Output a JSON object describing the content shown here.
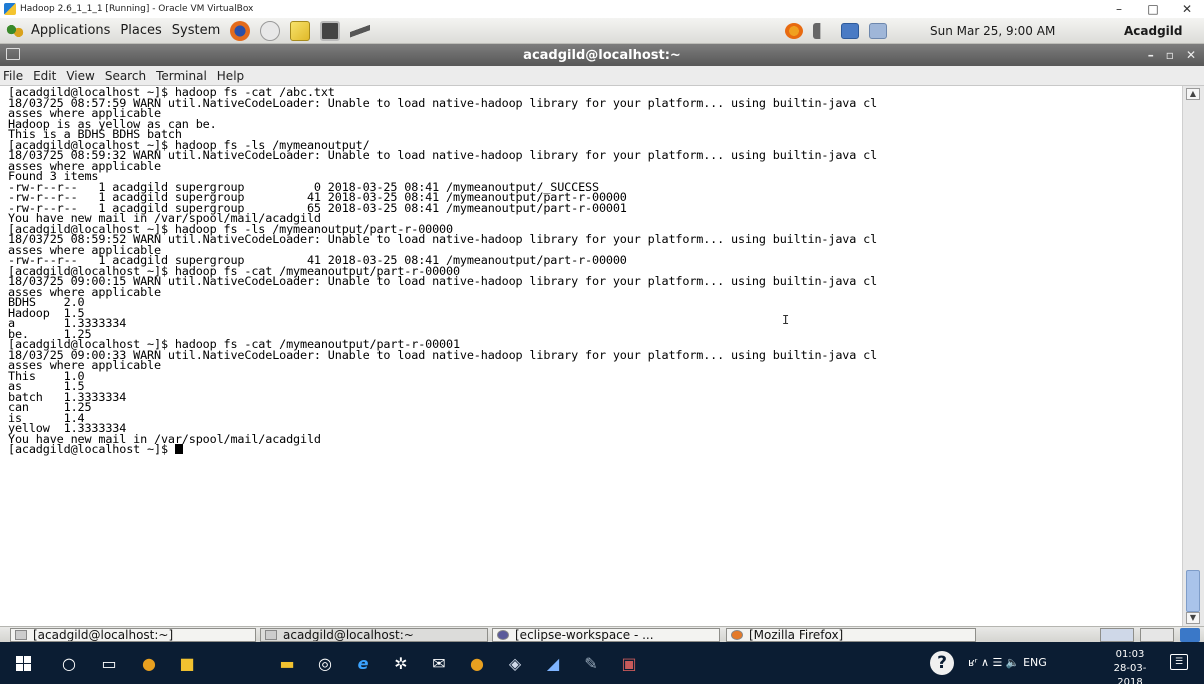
{
  "host_window": {
    "title": "Hadoop 2.6_1_1_1 [Running] - Oracle VM VirtualBox",
    "controls": [
      "–",
      "□",
      "✕"
    ]
  },
  "gnome_panel": {
    "menus": [
      "Applications",
      "Places",
      "System"
    ],
    "clock": "Sun Mar 25, 9:00 AM",
    "user": "Acadgild"
  },
  "terminal": {
    "title": "acadgild@localhost:~",
    "window_controls": [
      "–",
      "▫",
      "✕"
    ],
    "menu": [
      "File",
      "Edit",
      "View",
      "Search",
      "Terminal",
      "Help"
    ],
    "lines": [
      "[acadgild@localhost ~]$ hadoop fs -cat /abc.txt",
      "18/03/25 08:57:59 WARN util.NativeCodeLoader: Unable to load native-hadoop library for your platform... using builtin-java cl",
      "asses where applicable",
      "Hadoop is as yellow as can be.",
      "This is a BDHS BDHS batch",
      "[acadgild@localhost ~]$ hadoop fs -ls /mymeanoutput/",
      "18/03/25 08:59:32 WARN util.NativeCodeLoader: Unable to load native-hadoop library for your platform... using builtin-java cl",
      "asses where applicable",
      "Found 3 items",
      "-rw-r--r--   1 acadgild supergroup          0 2018-03-25 08:41 /mymeanoutput/_SUCCESS",
      "-rw-r--r--   1 acadgild supergroup         41 2018-03-25 08:41 /mymeanoutput/part-r-00000",
      "-rw-r--r--   1 acadgild supergroup         65 2018-03-25 08:41 /mymeanoutput/part-r-00001",
      "You have new mail in /var/spool/mail/acadgild",
      "[acadgild@localhost ~]$ hadoop fs -ls /mymeanoutput/part-r-00000",
      "18/03/25 08:59:52 WARN util.NativeCodeLoader: Unable to load native-hadoop library for your platform... using builtin-java cl",
      "asses where applicable",
      "-rw-r--r--   1 acadgild supergroup         41 2018-03-25 08:41 /mymeanoutput/part-r-00000",
      "[acadgild@localhost ~]$ hadoop fs -cat /mymeanoutput/part-r-00000",
      "18/03/25 09:00:15 WARN util.NativeCodeLoader: Unable to load native-hadoop library for your platform... using builtin-java cl",
      "asses where applicable",
      "BDHS    2.0",
      "Hadoop  1.5",
      "a       1.3333334",
      "be.     1.25",
      "[acadgild@localhost ~]$ hadoop fs -cat /mymeanoutput/part-r-00001",
      "18/03/25 09:00:33 WARN util.NativeCodeLoader: Unable to load native-hadoop library for your platform... using builtin-java cl",
      "asses where applicable",
      "This    1.0",
      "as      1.5",
      "batch   1.3333334",
      "can     1.25",
      "is      1.4",
      "yellow  1.3333334",
      "You have new mail in /var/spool/mail/acadgild"
    ],
    "prompt": "[acadgild@localhost ~]$ "
  },
  "guest_taskbar": {
    "buttons": [
      "[acadgild@localhost:~]",
      "acadgild@localhost:~",
      "[eclipse-workspace - ...",
      "[Mozilla Firefox]"
    ]
  },
  "windows_taskbar": {
    "tray_text": "ʁʳ  ∧  ☰  🔈  ENG",
    "time": "01:03",
    "date": "28-03-2018"
  }
}
